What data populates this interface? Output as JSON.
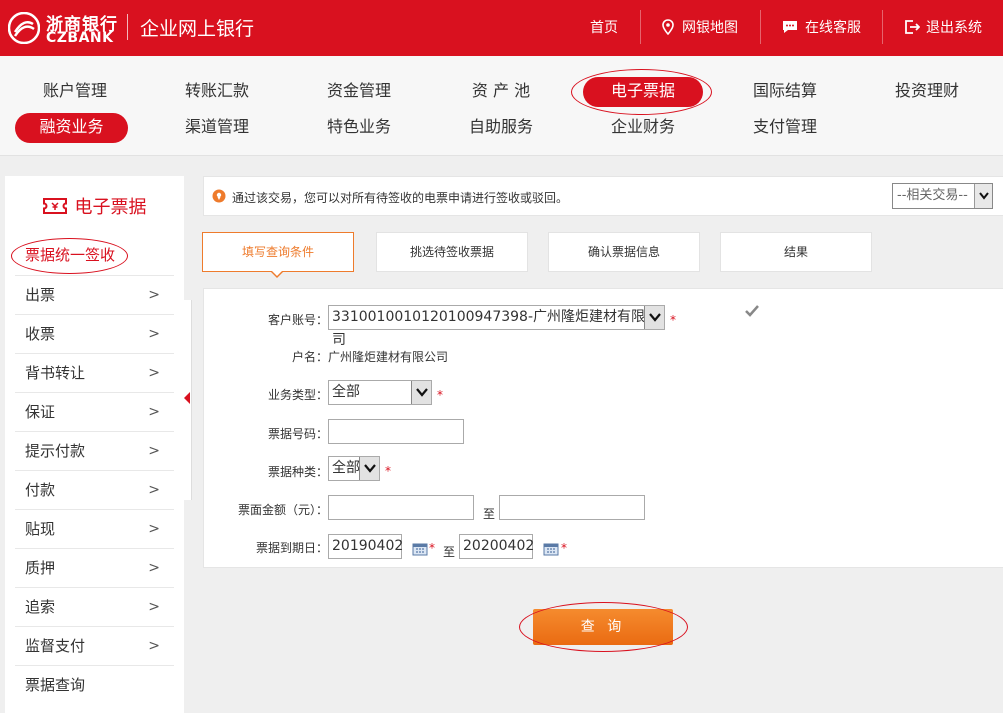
{
  "header": {
    "brand_cn": "浙商银行",
    "brand_en": "CZBANK",
    "title": "企业网上银行",
    "links": {
      "home": "首页",
      "sitemap": "网银地图",
      "support": "在线客服",
      "logout": "退出系统"
    }
  },
  "nav": {
    "row1": [
      "账户管理",
      "转账汇款",
      "资金管理",
      "资 产 池",
      "电子票据",
      "国际结算",
      "投资理财"
    ],
    "row2": [
      "融资业务",
      "渠道管理",
      "特色业务",
      "自助服务",
      "企业财务",
      "支付管理"
    ]
  },
  "sidebar": {
    "title": "电子票据",
    "items": [
      "票据统一签收",
      "出票",
      "收票",
      "背书转让",
      "保证",
      "提示付款",
      "付款",
      "贴现",
      "质押",
      "追索",
      "监督支付",
      "票据查询"
    ]
  },
  "notice": {
    "text": "通过该交易，您可以对所有待签收的电票申请进行签收或驳回。",
    "related_select": "--相关交易--"
  },
  "steps": [
    "填写查询条件",
    "挑选待签收票据",
    "确认票据信息",
    "结果"
  ],
  "form": {
    "account_label": "客户账号：",
    "account_value": "3310010010120100947398-广州隆炬建材有限公司",
    "name_label": "户名：",
    "name_value": "广州隆炬建材有限公司",
    "biz_type_label": "业务类型：",
    "biz_type_value": "全部",
    "bill_no_label": "票据号码：",
    "bill_no_value": "",
    "bill_kind_label": "票据种类：",
    "bill_kind_value": "全部",
    "amount_label": "票面金额（元）：",
    "amount_from": "",
    "amount_to": "",
    "to_text": "至",
    "due_label": "票据到期日：",
    "due_from": "20190402",
    "due_to": "20200402",
    "required_mark": "*"
  },
  "query_button": "查 询",
  "colors": {
    "brand_red": "#d9111f",
    "accent_orange": "#ee7b2c"
  }
}
